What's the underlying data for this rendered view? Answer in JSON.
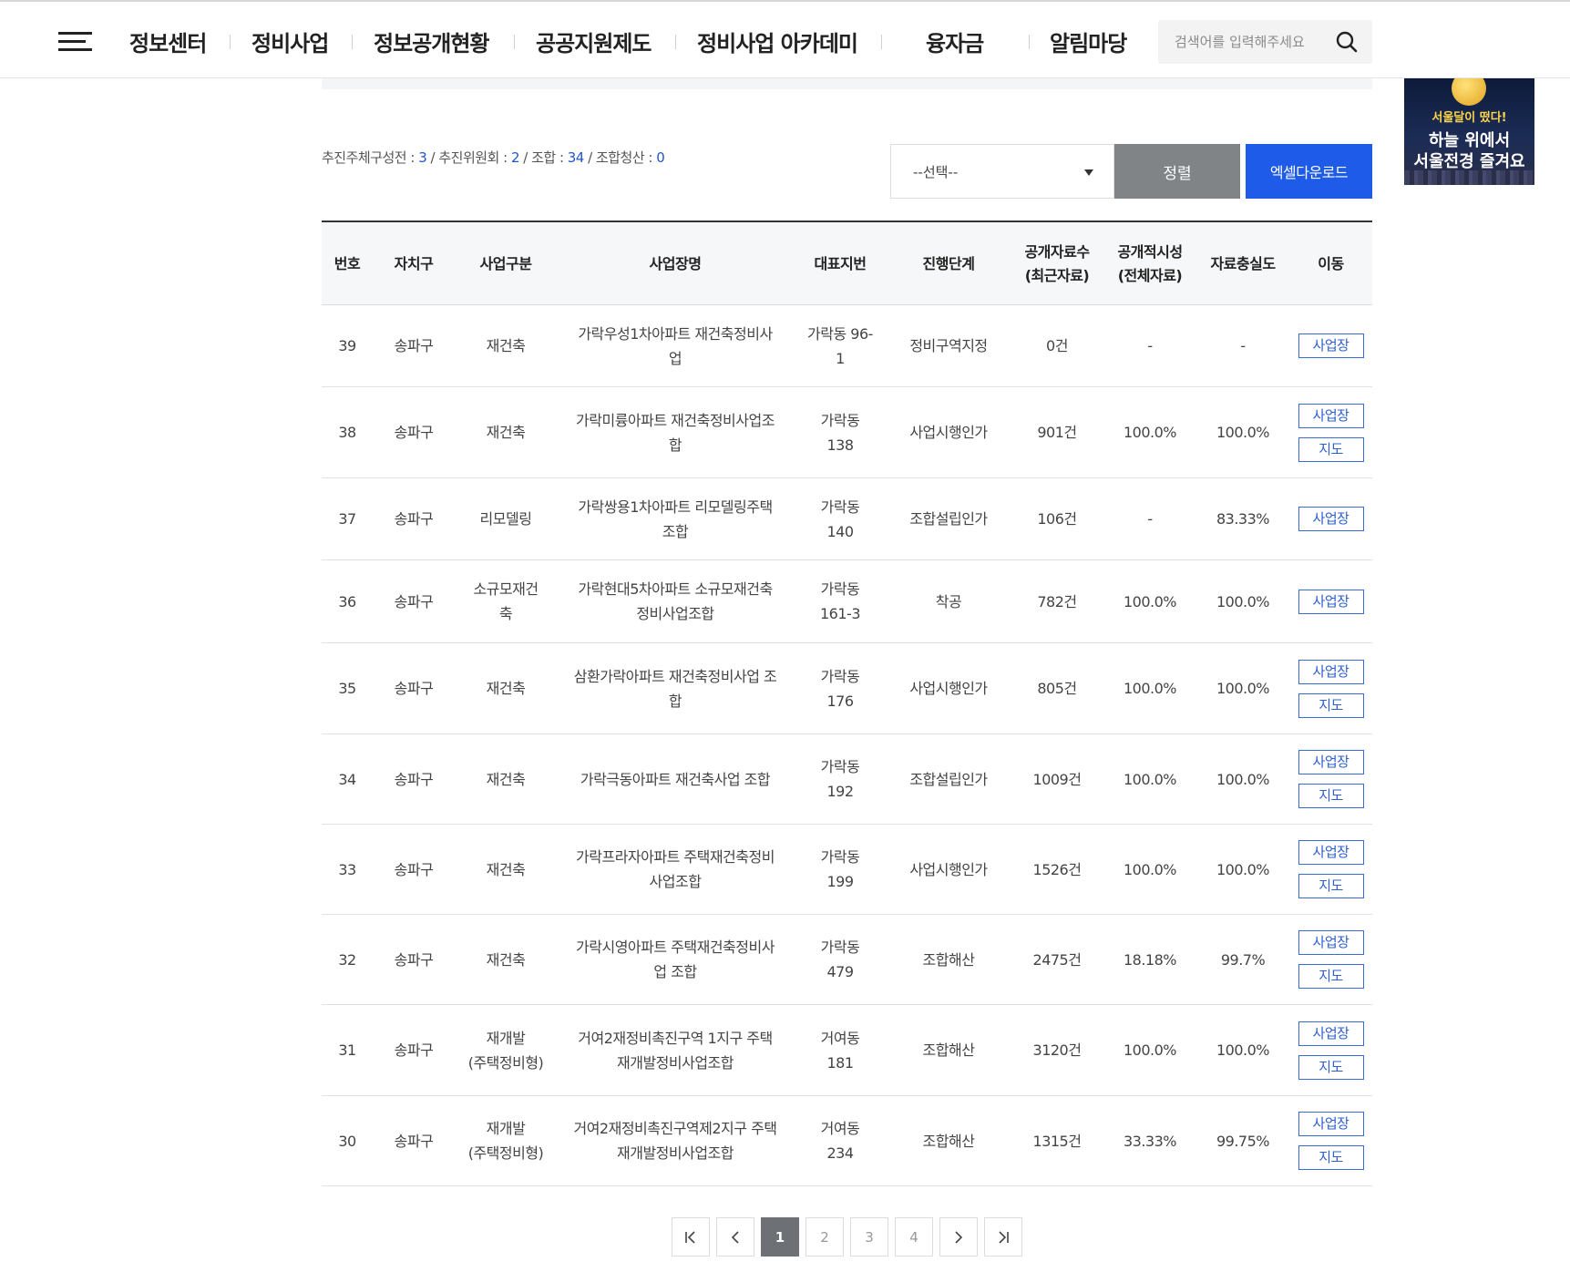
{
  "header": {
    "nav": [
      "정보센터",
      "정비사업",
      "정보공개현황",
      "공공지원제도",
      "정비사업 아카데미",
      "융자금",
      "알림마당"
    ],
    "search_placeholder": "검색어를 입력해주세요"
  },
  "banner": {
    "line1": "서울달이 떴다!",
    "line2": "하늘 위에서",
    "line3": "서울전경 즐겨요"
  },
  "summary": {
    "items": [
      {
        "label": "추진주체구성전 : ",
        "value": "3"
      },
      {
        "label": " / 추진위원회 : ",
        "value": "2"
      },
      {
        "label": " / 조합 : ",
        "value": "34"
      },
      {
        "label": " / 조합청산 : ",
        "value": "0"
      }
    ]
  },
  "controls": {
    "select_value": "--선택--",
    "sort_label": "정렬",
    "excel_label": "엑셀다운로드"
  },
  "table": {
    "headers": [
      "번호",
      "자치구",
      "사업구분",
      "사업장명",
      "대표지번",
      "진행단계",
      "공개자료수\n(최근자료)",
      "공개적시성\n(전체자료)",
      "자료충실도",
      "이동"
    ],
    "rows": [
      {
        "no": "39",
        "gu": "송파구",
        "type": "재건축",
        "name": "가락우성1차아파트 재건축정비사\n업",
        "lot": "가락동 96-\n1",
        "stage": "정비구역지정",
        "count": "0건",
        "timely": "-",
        "fidelity": "-",
        "buttons": [
          "사업장"
        ]
      },
      {
        "no": "38",
        "gu": "송파구",
        "type": "재건축",
        "name": "가락미륭아파트 재건축정비사업조\n합",
        "lot": "가락동\n138",
        "stage": "사업시행인가",
        "count": "901건",
        "timely": "100.0%",
        "fidelity": "100.0%",
        "buttons": [
          "사업장",
          "지도"
        ]
      },
      {
        "no": "37",
        "gu": "송파구",
        "type": "리모델링",
        "name": "가락쌍용1차아파트 리모델링주택\n조합",
        "lot": "가락동\n140",
        "stage": "조합설립인가",
        "count": "106건",
        "timely": "-",
        "fidelity": "83.33%",
        "buttons": [
          "사업장"
        ]
      },
      {
        "no": "36",
        "gu": "송파구",
        "type": "소규모재건\n축",
        "name": "가락현대5차아파트 소규모재건축\n정비사업조합",
        "lot": "가락동\n161-3",
        "stage": "착공",
        "count": "782건",
        "timely": "100.0%",
        "fidelity": "100.0%",
        "buttons": [
          "사업장"
        ]
      },
      {
        "no": "35",
        "gu": "송파구",
        "type": "재건축",
        "name": "삼환가락아파트 재건축정비사업 조\n합",
        "lot": "가락동\n176",
        "stage": "사업시행인가",
        "count": "805건",
        "timely": "100.0%",
        "fidelity": "100.0%",
        "buttons": [
          "사업장",
          "지도"
        ]
      },
      {
        "no": "34",
        "gu": "송파구",
        "type": "재건축",
        "name": "가락극동아파트 재건축사업 조합",
        "lot": "가락동\n192",
        "stage": "조합설립인가",
        "count": "1009건",
        "timely": "100.0%",
        "fidelity": "100.0%",
        "buttons": [
          "사업장",
          "지도"
        ]
      },
      {
        "no": "33",
        "gu": "송파구",
        "type": "재건축",
        "name": "가락프라자아파트 주택재건축정비\n사업조합",
        "lot": "가락동\n199",
        "stage": "사업시행인가",
        "count": "1526건",
        "timely": "100.0%",
        "fidelity": "100.0%",
        "buttons": [
          "사업장",
          "지도"
        ]
      },
      {
        "no": "32",
        "gu": "송파구",
        "type": "재건축",
        "name": "가락시영아파트 주택재건축정비사\n업 조합",
        "lot": "가락동\n479",
        "stage": "조합해산",
        "count": "2475건",
        "timely": "18.18%",
        "fidelity": "99.7%",
        "buttons": [
          "사업장",
          "지도"
        ]
      },
      {
        "no": "31",
        "gu": "송파구",
        "type": "재개발\n(주택정비형)",
        "name": "거여2재정비촉진구역 1지구 주택\n재개발정비사업조합",
        "lot": "거여동\n181",
        "stage": "조합해산",
        "count": "3120건",
        "timely": "100.0%",
        "fidelity": "100.0%",
        "buttons": [
          "사업장",
          "지도"
        ]
      },
      {
        "no": "30",
        "gu": "송파구",
        "type": "재개발\n(주택정비형)",
        "name": "거여2재정비촉진구역제2지구 주택\n재개발정비사업조합",
        "lot": "거여동\n234",
        "stage": "조합해산",
        "count": "1315건",
        "timely": "33.33%",
        "fidelity": "99.75%",
        "buttons": [
          "사업장",
          "지도"
        ]
      }
    ]
  },
  "pagination": {
    "pages": [
      "1",
      "2",
      "3",
      "4"
    ],
    "current": "1"
  },
  "icons": {
    "menu": "hamburger-icon",
    "search": "search-icon",
    "first": "first-page-icon",
    "prev": "prev-page-icon",
    "next": "next-page-icon",
    "last": "last-page-icon"
  },
  "colors": {
    "accent": "#1d5be8",
    "sort_button": "#818487",
    "link_blue": "#2255cc",
    "active_page": "#6d7176"
  }
}
